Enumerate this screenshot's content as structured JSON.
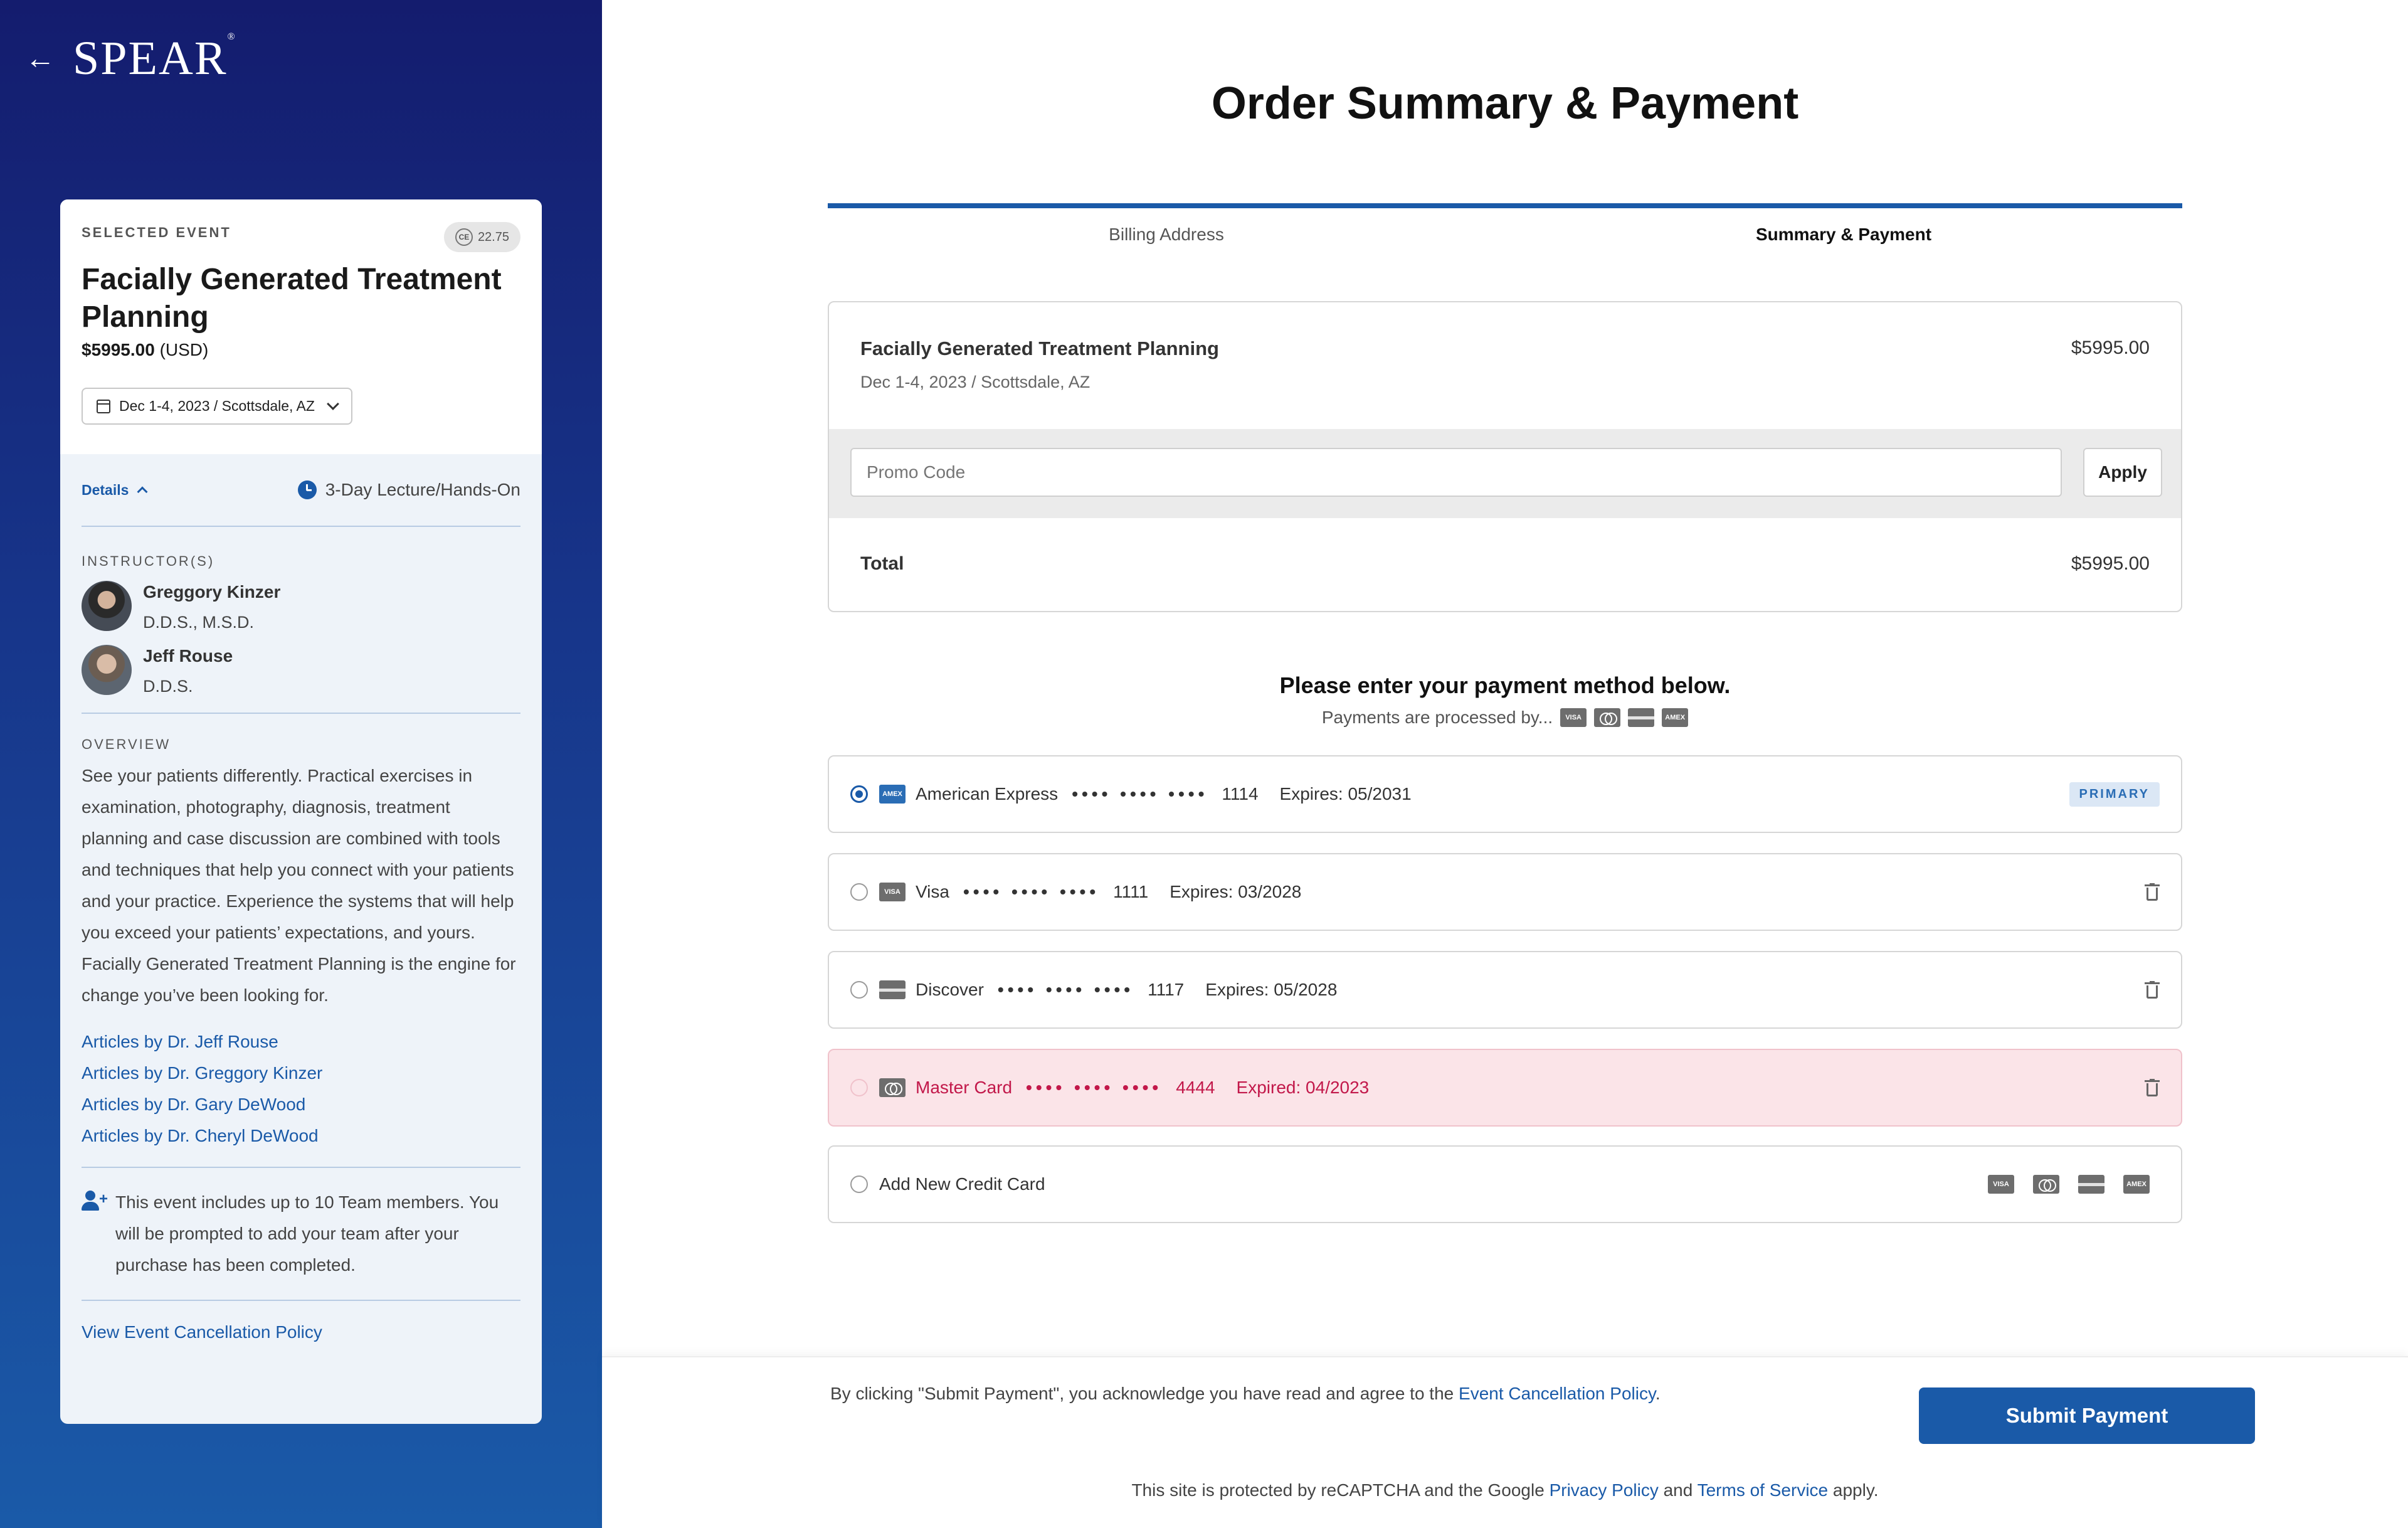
{
  "brand": {
    "logo": "SPEAR",
    "back_icon": "arrow-left-icon"
  },
  "event": {
    "selected_label": "SELECTED EVENT",
    "ce_credits": "22.75",
    "ce_icon_text": "CE",
    "title": "Facially Generated Treatment Planning",
    "price": "$5995.00",
    "currency": "(USD)",
    "date_location": "Dec 1-4, 2023 / Scottsdale, AZ",
    "details_label": "Details",
    "format": "3-Day Lecture/Hands-On",
    "instructors_label": "INSTRUCTOR(S)",
    "instructors": [
      {
        "name": "Greggory Kinzer",
        "credentials": "D.D.S., M.S.D."
      },
      {
        "name": "Jeff Rouse",
        "credentials": "D.D.S."
      }
    ],
    "overview_label": "OVERVIEW",
    "overview": "See your patients differently. Practical exercises in examination, photography, diagnosis, treatment planning and case discussion are combined with tools and techniques that help you connect with your patients and your practice. Experience the systems that will help you exceed your patients’ expectations, and yours. Facially Generated Treatment Planning is the engine for change you’ve been looking for.",
    "articles": [
      "Articles by Dr. Jeff Rouse",
      "Articles by Dr. Greggory Kinzer",
      "Articles by Dr. Gary DeWood",
      "Articles by Dr. Cheryl DeWood"
    ],
    "team_note": "This event includes up to 10 Team members. You will be prompted to add your team after your purchase has been completed.",
    "cancellation_link": "View Event Cancellation Policy"
  },
  "main": {
    "title": "Order Summary & Payment",
    "steps": [
      "Billing Address",
      "Summary & Payment"
    ],
    "summary": {
      "item": "Facially Generated Treatment Planning",
      "item_sub": "Dec 1-4, 2023 / Scottsdale, AZ",
      "item_price": "$5995.00",
      "promo_placeholder": "Promo Code",
      "apply_label": "Apply",
      "total_label": "Total",
      "total_price": "$5995.00"
    },
    "payment": {
      "heading": "Please enter your payment method below.",
      "processed_by": "Payments are processed by...",
      "methods": [
        {
          "brand": "American Express",
          "dots": "•••• •••• ••••",
          "last4": "1114",
          "expires": "Expires: 05/2031",
          "badge": "PRIMARY",
          "selected": true
        },
        {
          "brand": "Visa",
          "dots": "•••• •••• ••••",
          "last4": "1111",
          "expires": "Expires: 03/2028"
        },
        {
          "brand": "Discover",
          "dots": "•••• •••• ••••",
          "last4": "1117",
          "expires": "Expires: 05/2028"
        },
        {
          "brand": "Master Card",
          "dots": "•••• •••• ••••",
          "last4": "4444",
          "expires": "Expired: 04/2023",
          "expired": true
        }
      ],
      "add_new": "Add New Credit Card",
      "card_logos": [
        "VISA",
        "MC",
        "DISC",
        "AMEX"
      ]
    }
  },
  "footer": {
    "agree_prefix": "By clicking \"Submit Payment\", you acknowledge you have read and agree to the",
    "agree_link": "Event Cancellation Policy",
    "agree_suffix": ".",
    "submit_label": "Submit Payment",
    "recaptcha_prefix": "This site is protected by reCAPTCHA and the Google",
    "privacy_link": "Privacy Policy",
    "and": "and",
    "terms_link": "Terms of Service",
    "recaptcha_suffix": "apply."
  },
  "colors": {
    "accent": "#1a5aa8",
    "sidebar_top": "#141c6e",
    "expired_bg": "#fbe4e8",
    "expired_text": "#c2184a"
  }
}
